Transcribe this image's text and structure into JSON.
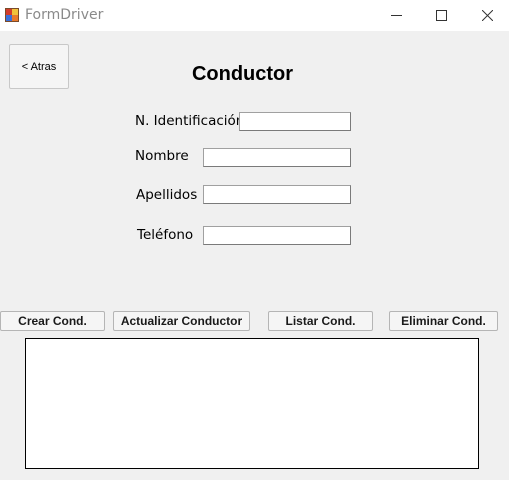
{
  "window": {
    "title": "FormDriver",
    "controls": {
      "minimize": "minimize-icon",
      "maximize": "maximize-icon",
      "close": "close-icon"
    }
  },
  "back_button": {
    "label": "< Atras"
  },
  "heading": "Conductor",
  "form": {
    "fields": [
      {
        "label": "N. Identificación",
        "value": ""
      },
      {
        "label": "Nombre",
        "value": ""
      },
      {
        "label": "Apellidos",
        "value": ""
      },
      {
        "label": "Teléfono",
        "value": ""
      }
    ]
  },
  "actions": {
    "create": "Crear Cond.",
    "update": "Actualizar Conductor",
    "list": "Listar Cond.",
    "delete": "Eliminar Cond."
  },
  "results": {
    "items": []
  },
  "colors": {
    "window_bg": "#f0f0f0",
    "titlebar_bg": "#ffffff",
    "list_border": "#000000"
  }
}
